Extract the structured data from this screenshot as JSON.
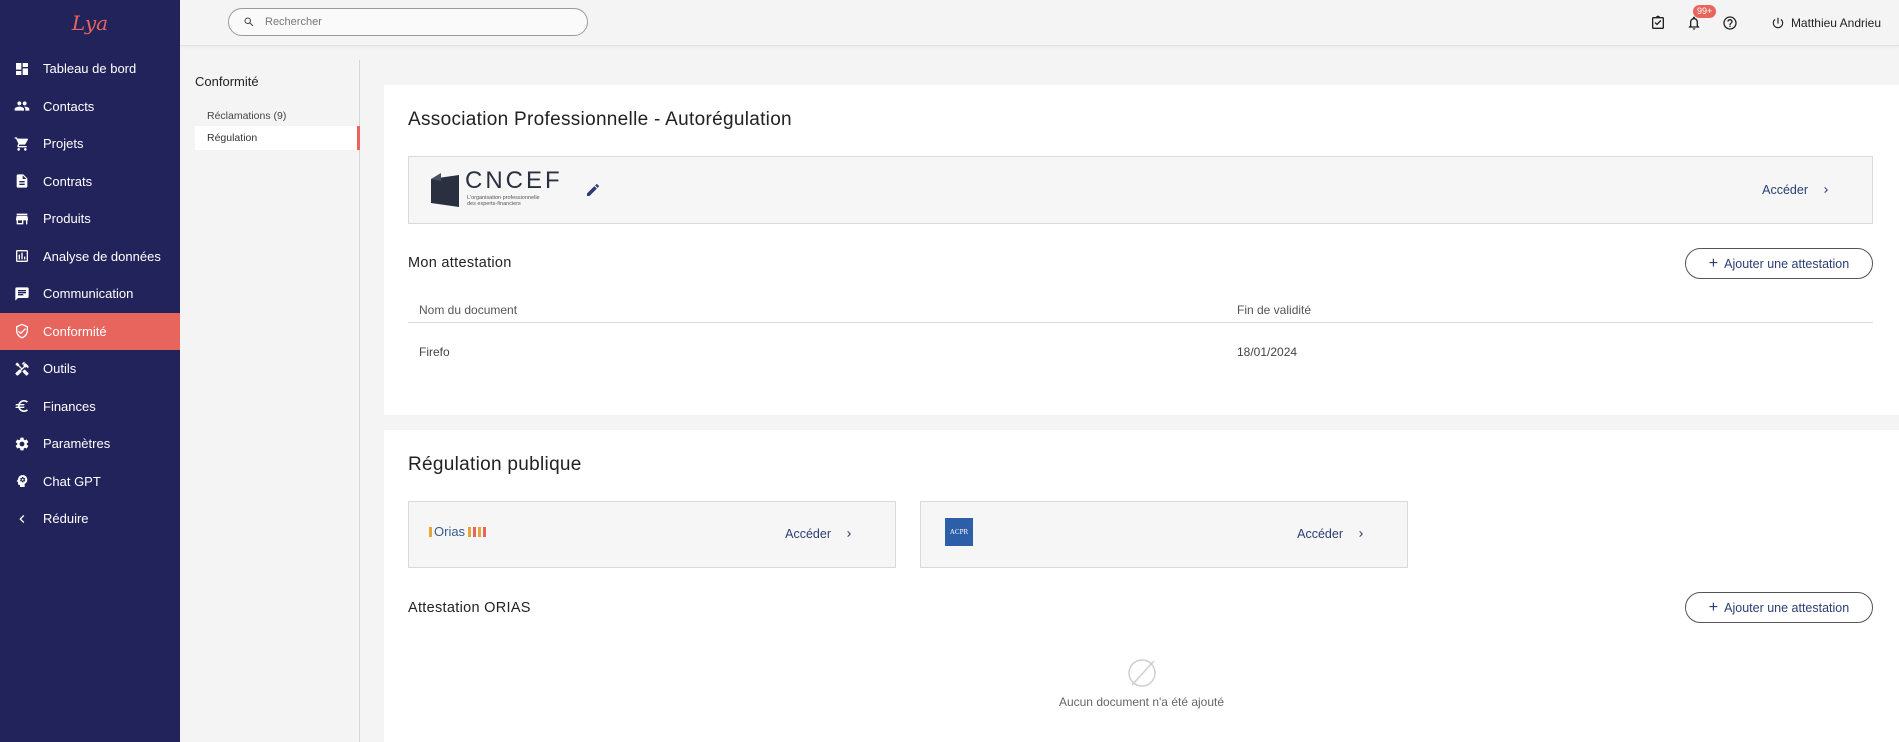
{
  "app": {
    "logo_text": "Lya"
  },
  "sidebar": {
    "items": [
      {
        "label": "Tableau de bord",
        "icon": "dashboard-icon"
      },
      {
        "label": "Contacts",
        "icon": "people-icon"
      },
      {
        "label": "Projets",
        "icon": "cart-icon"
      },
      {
        "label": "Contrats",
        "icon": "document-icon"
      },
      {
        "label": "Produits",
        "icon": "store-icon"
      },
      {
        "label": "Analyse de données",
        "icon": "bar-chart-icon"
      },
      {
        "label": "Communication",
        "icon": "message-icon"
      },
      {
        "label": "Conformité",
        "icon": "shield-check-icon",
        "active": true
      },
      {
        "label": "Outils",
        "icon": "tools-icon"
      },
      {
        "label": "Finances",
        "icon": "euro-icon"
      },
      {
        "label": "Paramètres",
        "icon": "gear-icon"
      },
      {
        "label": "Chat GPT",
        "icon": "robot-icon"
      },
      {
        "label": "Réduire",
        "icon": "chevron-left-icon"
      }
    ]
  },
  "topbar": {
    "search_placeholder": "Rechercher",
    "notification_badge": "99+",
    "user_name": "Matthieu Andrieu"
  },
  "subnav": {
    "title": "Conformité",
    "items": [
      {
        "label": "Réclamations (9)"
      },
      {
        "label": "Régulation",
        "active": true
      }
    ]
  },
  "association": {
    "title": "Association Professionnelle - Autorégulation",
    "logo_name": "CNCEF",
    "logo_tagline_1": "L'organisation professionnelle",
    "logo_tagline_2": "des experts-financiers",
    "access_label": "Accéder"
  },
  "attestation": {
    "title": "Mon attestation",
    "add_label": "Ajouter une attestation",
    "columns": [
      "Nom du document",
      "Fin de validité"
    ],
    "rows": [
      {
        "name": "Firefo",
        "end_date": "18/01/2024"
      }
    ]
  },
  "public_regulation": {
    "title": "Régulation publique",
    "orias_logo_text": "Orias",
    "acpr_logo_text": "ACPR",
    "access_label": "Accéder"
  },
  "orias_attestation": {
    "title": "Attestation ORIAS",
    "add_label": "Ajouter une attestation",
    "empty_message": "Aucun document n'a été ajouté"
  },
  "colors": {
    "sidebar_bg": "#23235b",
    "accent": "#e8655d",
    "link": "#2a3e73"
  }
}
